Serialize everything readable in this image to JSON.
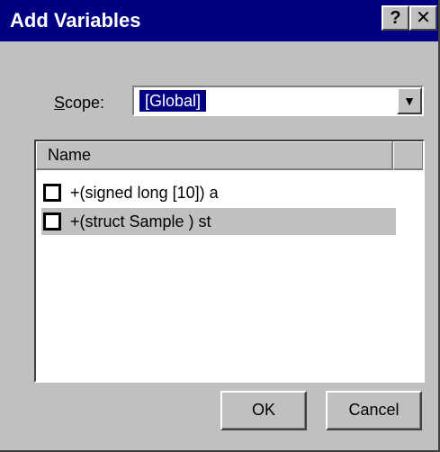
{
  "window": {
    "title": "Add Variables",
    "help_button": "?",
    "close_button": "✕"
  },
  "scope": {
    "label_accel": "S",
    "label_rest": "cope:",
    "selected_value": "[Global]",
    "dropdown_arrow": "▼"
  },
  "list": {
    "column_header": "Name",
    "rows": [
      {
        "label": "+(signed long [10]) a",
        "checked": false,
        "selected": false
      },
      {
        "label": "+(struct Sample ) st",
        "checked": false,
        "selected": true
      }
    ]
  },
  "buttons": {
    "ok_label": "OK",
    "cancel_label": "Cancel"
  },
  "colors": {
    "title_bar": "#000080",
    "face": "#c0c0c0",
    "selection": "#000080"
  }
}
